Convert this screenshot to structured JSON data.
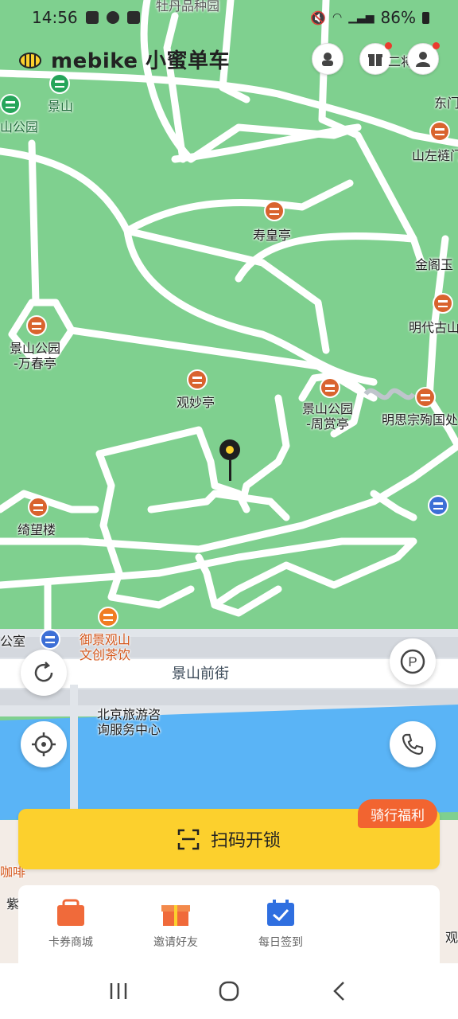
{
  "status_bar": {
    "time": "14:56",
    "battery": "86%"
  },
  "header": {
    "brand_name": "mebike 小蜜单车",
    "side_label": "二将"
  },
  "map": {
    "labels": {
      "top": "牡丹品种园",
      "jingshan": "景山",
      "park": "山公园",
      "dongmen": "东门",
      "shanzuo": "山左裢门",
      "shouhuang": "寿皇亭",
      "jinge": "金阁玉",
      "mingdai": "明代古山",
      "wanchun": "景山公园\n-万春亭",
      "guanmiao": "观妙亭",
      "zhoushang": "景山公园\n-周赏亭",
      "mingsi": "明思宗殉国处",
      "qiwang": "绮望楼",
      "yujing": "御景观山\n文创茶饮",
      "office": "公室",
      "street": "景山前街",
      "tourism": "北京旅游咨\n询服务中心",
      "coffee": "咖啡",
      "zi": "紫",
      "guan": "观"
    }
  },
  "scan": {
    "label": "扫码开锁",
    "promo": "骑行福利"
  },
  "bottom": {
    "items": [
      {
        "label": "卡券商城"
      },
      {
        "label": "邀请好友"
      },
      {
        "label": "每日签到"
      }
    ]
  },
  "colors": {
    "park": "#7fd08f",
    "water": "#5ab4f6",
    "road": "#dfe3e8",
    "accent": "#fcd02d",
    "promo": "#f26430"
  }
}
